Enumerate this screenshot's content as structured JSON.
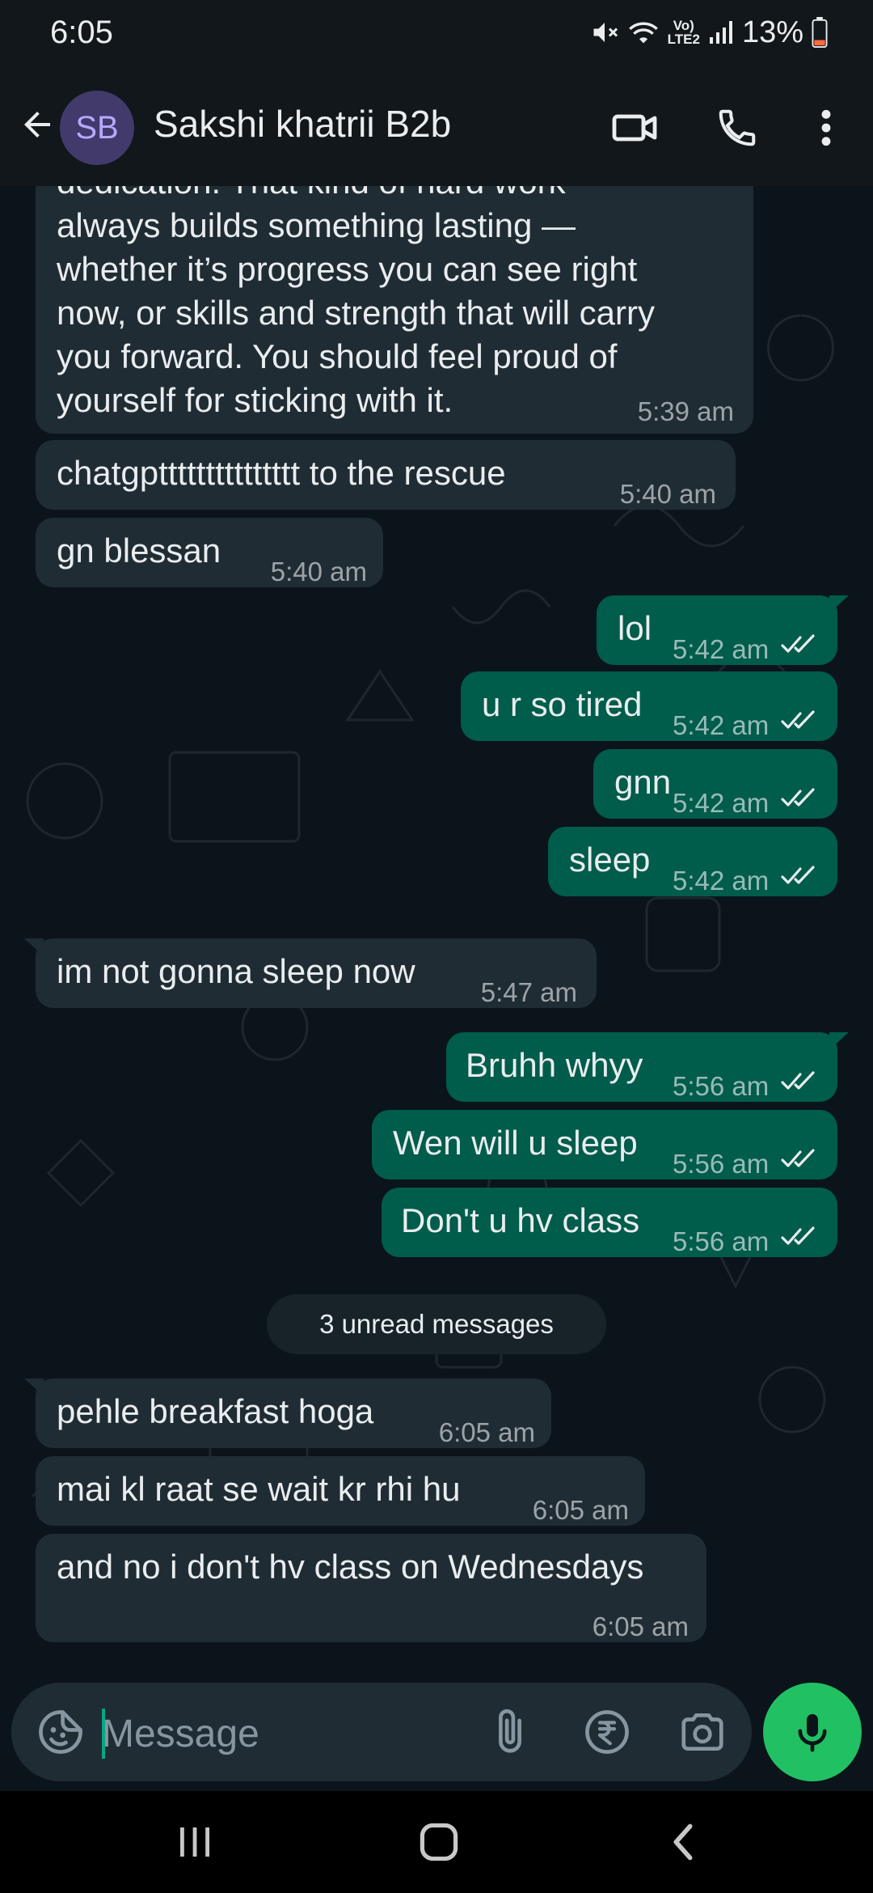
{
  "status_bar": {
    "time": "6:05",
    "network_label_top": "Vo)",
    "network_label_bottom": "LTE2",
    "battery": "13%"
  },
  "header": {
    "avatar_initials": "SB",
    "contact_name": "Sakshi khatrii B2b",
    "icons": [
      "back-arrow-icon",
      "video-call-icon",
      "voice-call-icon",
      "more-options-icon"
    ]
  },
  "messages": [
    {
      "dir": "in",
      "text_lines": [
        "always builds something lasting —",
        "whether it’s progress you can see right",
        "now, or skills and strength that will carry",
        "you forward. You should feel proud of",
        "yourself for sticking with it."
      ],
      "time": "5:39 am"
    },
    {
      "dir": "in",
      "text": "chatgpttttttttttttttt to the rescue",
      "time": "5:40 am"
    },
    {
      "dir": "in",
      "text": "gn blessan",
      "time": "5:40 am"
    },
    {
      "dir": "out",
      "text": "lol",
      "time": "5:42 am",
      "status": "read"
    },
    {
      "dir": "out",
      "text": "u r so tired",
      "time": "5:42 am",
      "status": "read"
    },
    {
      "dir": "out",
      "text": "gnn",
      "time": "5:42 am",
      "status": "read"
    },
    {
      "dir": "out",
      "text": "sleep",
      "time": "5:42 am",
      "status": "read"
    },
    {
      "dir": "in",
      "text": "im not gonna sleep now",
      "time": "5:47 am"
    },
    {
      "dir": "out",
      "text": "Bruhh whyy",
      "time": "5:56 am",
      "status": "read"
    },
    {
      "dir": "out",
      "text": "Wen will u sleep",
      "time": "5:56 am",
      "status": "read"
    },
    {
      "dir": "out",
      "text": "Don't u hv class",
      "time": "5:56 am",
      "status": "read"
    },
    {
      "dir": "in",
      "text": "pehle breakfast hoga",
      "time": "6:05 am"
    },
    {
      "dir": "in",
      "text": "mai kl raat se wait kr rhi hu",
      "time": "6:05 am"
    },
    {
      "dir": "in",
      "text": "and no i don't hv class on Wednesdays",
      "time": "6:05 am"
    }
  ],
  "unread_divider": "3 unread messages",
  "composer": {
    "placeholder": "Message",
    "icons": [
      "emoji-sticker-icon",
      "attach-icon",
      "rupee-payment-icon",
      "camera-icon",
      "mic-icon"
    ]
  },
  "colors": {
    "background": "#0b141a",
    "incoming_bubble": "#202c33",
    "outgoing_bubble": "#005c4b",
    "accent_green": "#21c063",
    "read_ticks": "#e9edef"
  }
}
